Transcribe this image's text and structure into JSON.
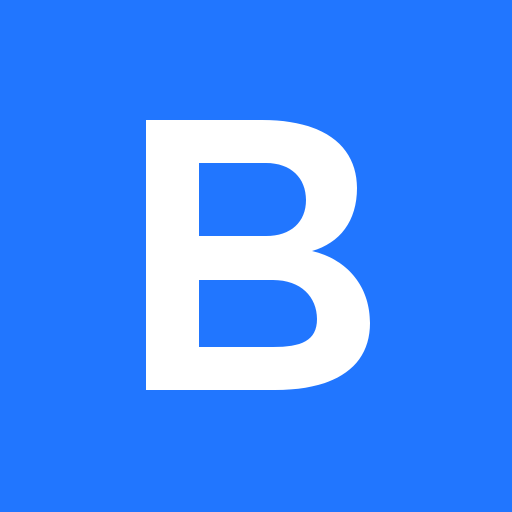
{
  "icon": {
    "logo_name": "letter-b-logo-icon",
    "logo_text": "B",
    "background_color": "#2176ff",
    "foreground_color": "#ffffff"
  }
}
